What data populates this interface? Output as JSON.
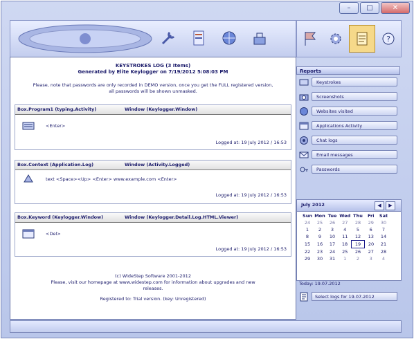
{
  "window": {
    "title": "",
    "caption_buttons": [
      "–",
      "□",
      "✕"
    ]
  },
  "toolbar": {
    "icons": [
      "wrench-icon",
      "document-icon",
      "globe-icon",
      "tools-icon"
    ],
    "right_icons": [
      "flag-icon",
      "gear-icon",
      "notes-icon",
      "help-icon"
    ]
  },
  "report": {
    "title": "KEYSTROKES LOG (3 Items)",
    "subtitle": "Generated by Elite Keylogger on 7/19/2012 5:08:03 PM",
    "note_line1": "Please, note that passwords are only recorded in DEMO version, once you get the FULL registered version,",
    "note_line2": "all passwords will be shown unmasked.",
    "entries": [
      {
        "col1": "Box.Program1 (typing.Activity)",
        "col2": "Window (Keylogger.Window)",
        "text": "<Enter>",
        "logged": "Logged at: 19 July 2012 / 16:53"
      },
      {
        "col1": "Box.Context (Application.Log)",
        "col2": "Window (Activity.Logged)",
        "text": "text <Space><Up> <Enter> www.example.com <Enter>",
        "logged": "Logged at: 19 July 2012 / 16:53"
      },
      {
        "col1": "Box.Keyword (Keylogger.Window)",
        "col2": "Window (Keylogger.Detail.Log.HTML.Viewer)",
        "text": "<Del>",
        "logged": "Logged at: 19 July 2012 / 16:53"
      }
    ],
    "footer_line1": "(c) WideStep Software 2001-2012",
    "footer_line2": "Please, visit our homepage at www.widestep.com for information about upgrades and new",
    "footer_line3": "releases.",
    "footer_line4": "Registered to: Trial version. (key: Unregistered)"
  },
  "sidebar": {
    "header": "Reports",
    "items": [
      {
        "label": "Keystrokes",
        "icon": "keyboard-icon"
      },
      {
        "label": "Screenshots",
        "icon": "camera-icon"
      },
      {
        "label": "Websites visited",
        "icon": "globe-icon"
      },
      {
        "label": "Applications Activity",
        "icon": "window-icon"
      },
      {
        "label": "Chat logs",
        "icon": "chat-icon"
      },
      {
        "label": "Email messages",
        "icon": "email-icon"
      },
      {
        "label": "Passwords",
        "icon": "key-icon"
      }
    ]
  },
  "calendar": {
    "title": "July 2012",
    "prev": "◀",
    "next": "▶",
    "weekdays": [
      "Sun",
      "Mon",
      "Tue",
      "Wed",
      "Thu",
      "Fri",
      "Sat"
    ],
    "weeks": [
      [
        "24",
        "25",
        "26",
        "27",
        "28",
        "29",
        "30"
      ],
      [
        "1",
        "2",
        "3",
        "4",
        "5",
        "6",
        "7"
      ],
      [
        "8",
        "9",
        "10",
        "11",
        "12",
        "13",
        "14"
      ],
      [
        "15",
        "16",
        "17",
        "18",
        "19",
        "20",
        "21"
      ],
      [
        "22",
        "23",
        "24",
        "25",
        "26",
        "27",
        "28"
      ],
      [
        "29",
        "30",
        "31",
        "1",
        "2",
        "3",
        "4"
      ]
    ],
    "today_label": "Today: 19.07.2012",
    "task_label": "Select logs for 19.07.2012"
  }
}
